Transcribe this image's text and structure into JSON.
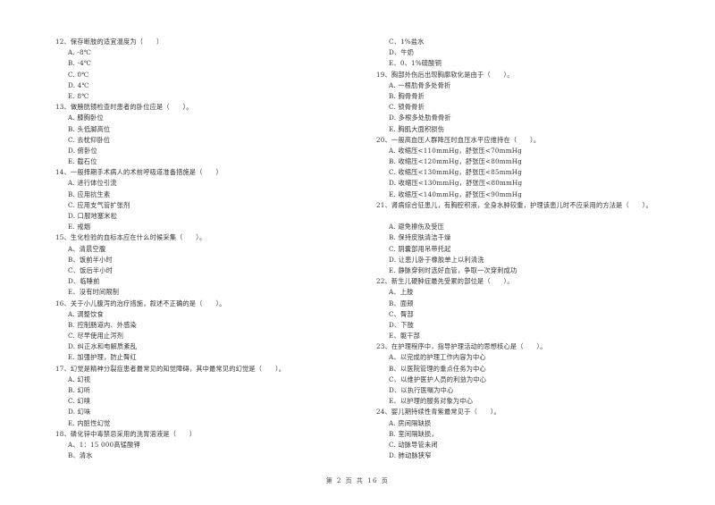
{
  "document": {
    "left_column": [
      {
        "type": "question",
        "text": "12、保存断肢的适宜温度为（　　）"
      },
      {
        "type": "option",
        "text": "A. -8℃"
      },
      {
        "type": "option",
        "text": "B. -4℃"
      },
      {
        "type": "option",
        "text": "C. 0℃"
      },
      {
        "type": "option",
        "text": "D. 4℃"
      },
      {
        "type": "option",
        "text": "E. 8℃"
      },
      {
        "type": "question",
        "text": "13、做膀胱镜检查时患者的卧位应是（　　）。"
      },
      {
        "type": "option",
        "text": "A.  膝胸卧位"
      },
      {
        "type": "option",
        "text": "B.  头低脚高位"
      },
      {
        "type": "option",
        "text": "C.  去枕仰卧位"
      },
      {
        "type": "option",
        "text": "D.  俯卧位"
      },
      {
        "type": "option",
        "text": "E.  截石位"
      },
      {
        "type": "question",
        "text": "14、一般择期手术病人的术前呼吸道准备措施是（　　）"
      },
      {
        "type": "option",
        "text": "A. 进行体位引流"
      },
      {
        "type": "option",
        "text": "B. 应用抗生素"
      },
      {
        "type": "option",
        "text": "C. 应用支气管扩张剂"
      },
      {
        "type": "option",
        "text": "D. 口服地塞米松"
      },
      {
        "type": "option",
        "text": "E. 戒烟"
      },
      {
        "type": "question",
        "text": "15、生化检验的血标本应在什么时候采集（　　）。"
      },
      {
        "type": "option",
        "text": "A、清晨空腹"
      },
      {
        "type": "option",
        "text": "B、饭前半小时"
      },
      {
        "type": "option",
        "text": "C、饭后半小时"
      },
      {
        "type": "option",
        "text": "D、临睡前"
      },
      {
        "type": "option",
        "text": "E、没有时间限制"
      },
      {
        "type": "question",
        "text": "16、关于小儿腹泻的治疗措施，叙述不正确的是（　　）。"
      },
      {
        "type": "option",
        "text": "A. 调整饮食"
      },
      {
        "type": "option",
        "text": "B. 控制肠道内、外感染"
      },
      {
        "type": "option",
        "text": "C. 尽早使用止泻剂"
      },
      {
        "type": "option",
        "text": "D. 纠正水和电解质紊乱"
      },
      {
        "type": "option",
        "text": "E. 加强护理，防止臀红"
      },
      {
        "type": "question",
        "text": "17、幻觉是精神分裂症患者最常见的知觉障碍，其中最常见的幻觉是（　　）。"
      },
      {
        "type": "option",
        "text": "A. 幻视"
      },
      {
        "type": "option",
        "text": "B. 幻听"
      },
      {
        "type": "option",
        "text": "C. 幻嗅"
      },
      {
        "type": "option",
        "text": "D. 幻味"
      },
      {
        "type": "option",
        "text": "E. 内脏性幻觉"
      },
      {
        "type": "question",
        "text": "18、磷化锌中毒禁忌采用的洗胃溶液是（　　）"
      },
      {
        "type": "option",
        "text": "A、1：15 000高锰酸钾"
      },
      {
        "type": "option",
        "text": "B、清水"
      }
    ],
    "right_column": [
      {
        "type": "option",
        "text": "C、1%盐水"
      },
      {
        "type": "option",
        "text": "D、牛奶"
      },
      {
        "type": "option",
        "text": "E、0、1%硫酸铜"
      },
      {
        "type": "question",
        "text": "19、胸部外伤后出现胸廓软化是由于（　　）。"
      },
      {
        "type": "option",
        "text": "A. 一根肋骨多处骨折"
      },
      {
        "type": "option",
        "text": "B. 胸骨骨折"
      },
      {
        "type": "option",
        "text": "C. 锁骨骨折"
      },
      {
        "type": "option",
        "text": "D. 多根多处肋骨骨折"
      },
      {
        "type": "option",
        "text": "E. 胸肌大面积损伤"
      },
      {
        "type": "question",
        "text": "20、一般高血压人群降压时血压水平应维持在（　　）。"
      },
      {
        "type": "option",
        "text": "A. 收缩压<110mmHg，舒张压<70mmHg"
      },
      {
        "type": "option",
        "text": "B. 收缩压<120mmHg，舒张压<80mmHg"
      },
      {
        "type": "option",
        "text": "C. 收缩压<130mmHg，舒张压<85mmHg"
      },
      {
        "type": "option",
        "text": "D. 收缩压<130mmHg，舒张压<80mmHg"
      },
      {
        "type": "option",
        "text": "E. 收缩压<140mmHg，舒张压<90mmHg"
      },
      {
        "type": "question",
        "text": "21、肾病综合征患儿，有胸腔积液，全身水肿较重，护理该患儿时不应采用的方法是（　　）。"
      },
      {
        "type": "gap",
        "text": ""
      },
      {
        "type": "option",
        "text": "A. 避免擦伤及受压"
      },
      {
        "type": "option",
        "text": "B. 保持皮肤清洁干燥"
      },
      {
        "type": "option",
        "text": "C. 阴囊部用吊带托起"
      },
      {
        "type": "option",
        "text": "D. 让患儿卧于橡胶单上以利清洗"
      },
      {
        "type": "option",
        "text": "E. 静脉穿刺时选好血管，争取一次穿刺成功"
      },
      {
        "type": "question",
        "text": "22、新生儿硬肿症最先受累的部位是（　　）。"
      },
      {
        "type": "option",
        "text": "A、上肢"
      },
      {
        "type": "option",
        "text": "B、面颊"
      },
      {
        "type": "option",
        "text": "C、臀部"
      },
      {
        "type": "option",
        "text": "D、下肢"
      },
      {
        "type": "option",
        "text": "E、躯干部"
      },
      {
        "type": "question",
        "text": "23、在护理程序中，指导护理活动的思想核心是（　　）。"
      },
      {
        "type": "option",
        "text": "A、以完成的护理工作内容为中心"
      },
      {
        "type": "option",
        "text": "B、以医院管理的重点任务为中心"
      },
      {
        "type": "option",
        "text": "C、以维护医护人员的利益为中心"
      },
      {
        "type": "option",
        "text": "D、以执行医嘱为中心"
      },
      {
        "type": "option",
        "text": "E、以护理的服务对象为中心"
      },
      {
        "type": "question",
        "text": "24、婴儿期持续性青紫最常见于（　　）。"
      },
      {
        "type": "option",
        "text": "A. 房间隔缺损"
      },
      {
        "type": "option",
        "text": "B. 室间隔缺损，"
      },
      {
        "type": "option",
        "text": "C. 动脉导管未闭"
      },
      {
        "type": "option",
        "text": "D. 肺动脉狭窄"
      }
    ],
    "footer": "第 2 页 共 16 页"
  }
}
